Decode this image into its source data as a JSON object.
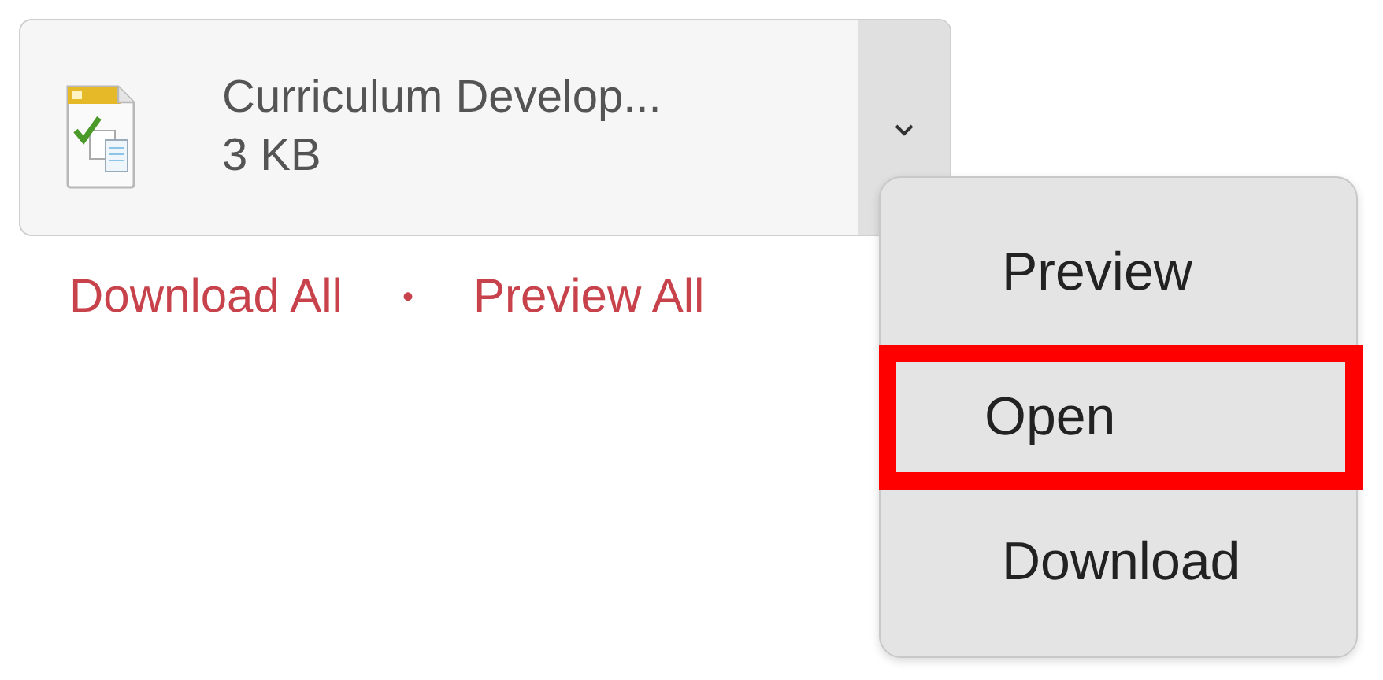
{
  "attachment": {
    "name": "Curriculum Develop...",
    "size": "3 KB"
  },
  "links": [
    {
      "label": "Download All"
    },
    {
      "label": "Preview All"
    }
  ],
  "separator": "•",
  "menu": {
    "items": [
      {
        "label": "Preview",
        "highlighted": false
      },
      {
        "label": "Open",
        "highlighted": true
      },
      {
        "label": "Download",
        "highlighted": false
      }
    ]
  }
}
